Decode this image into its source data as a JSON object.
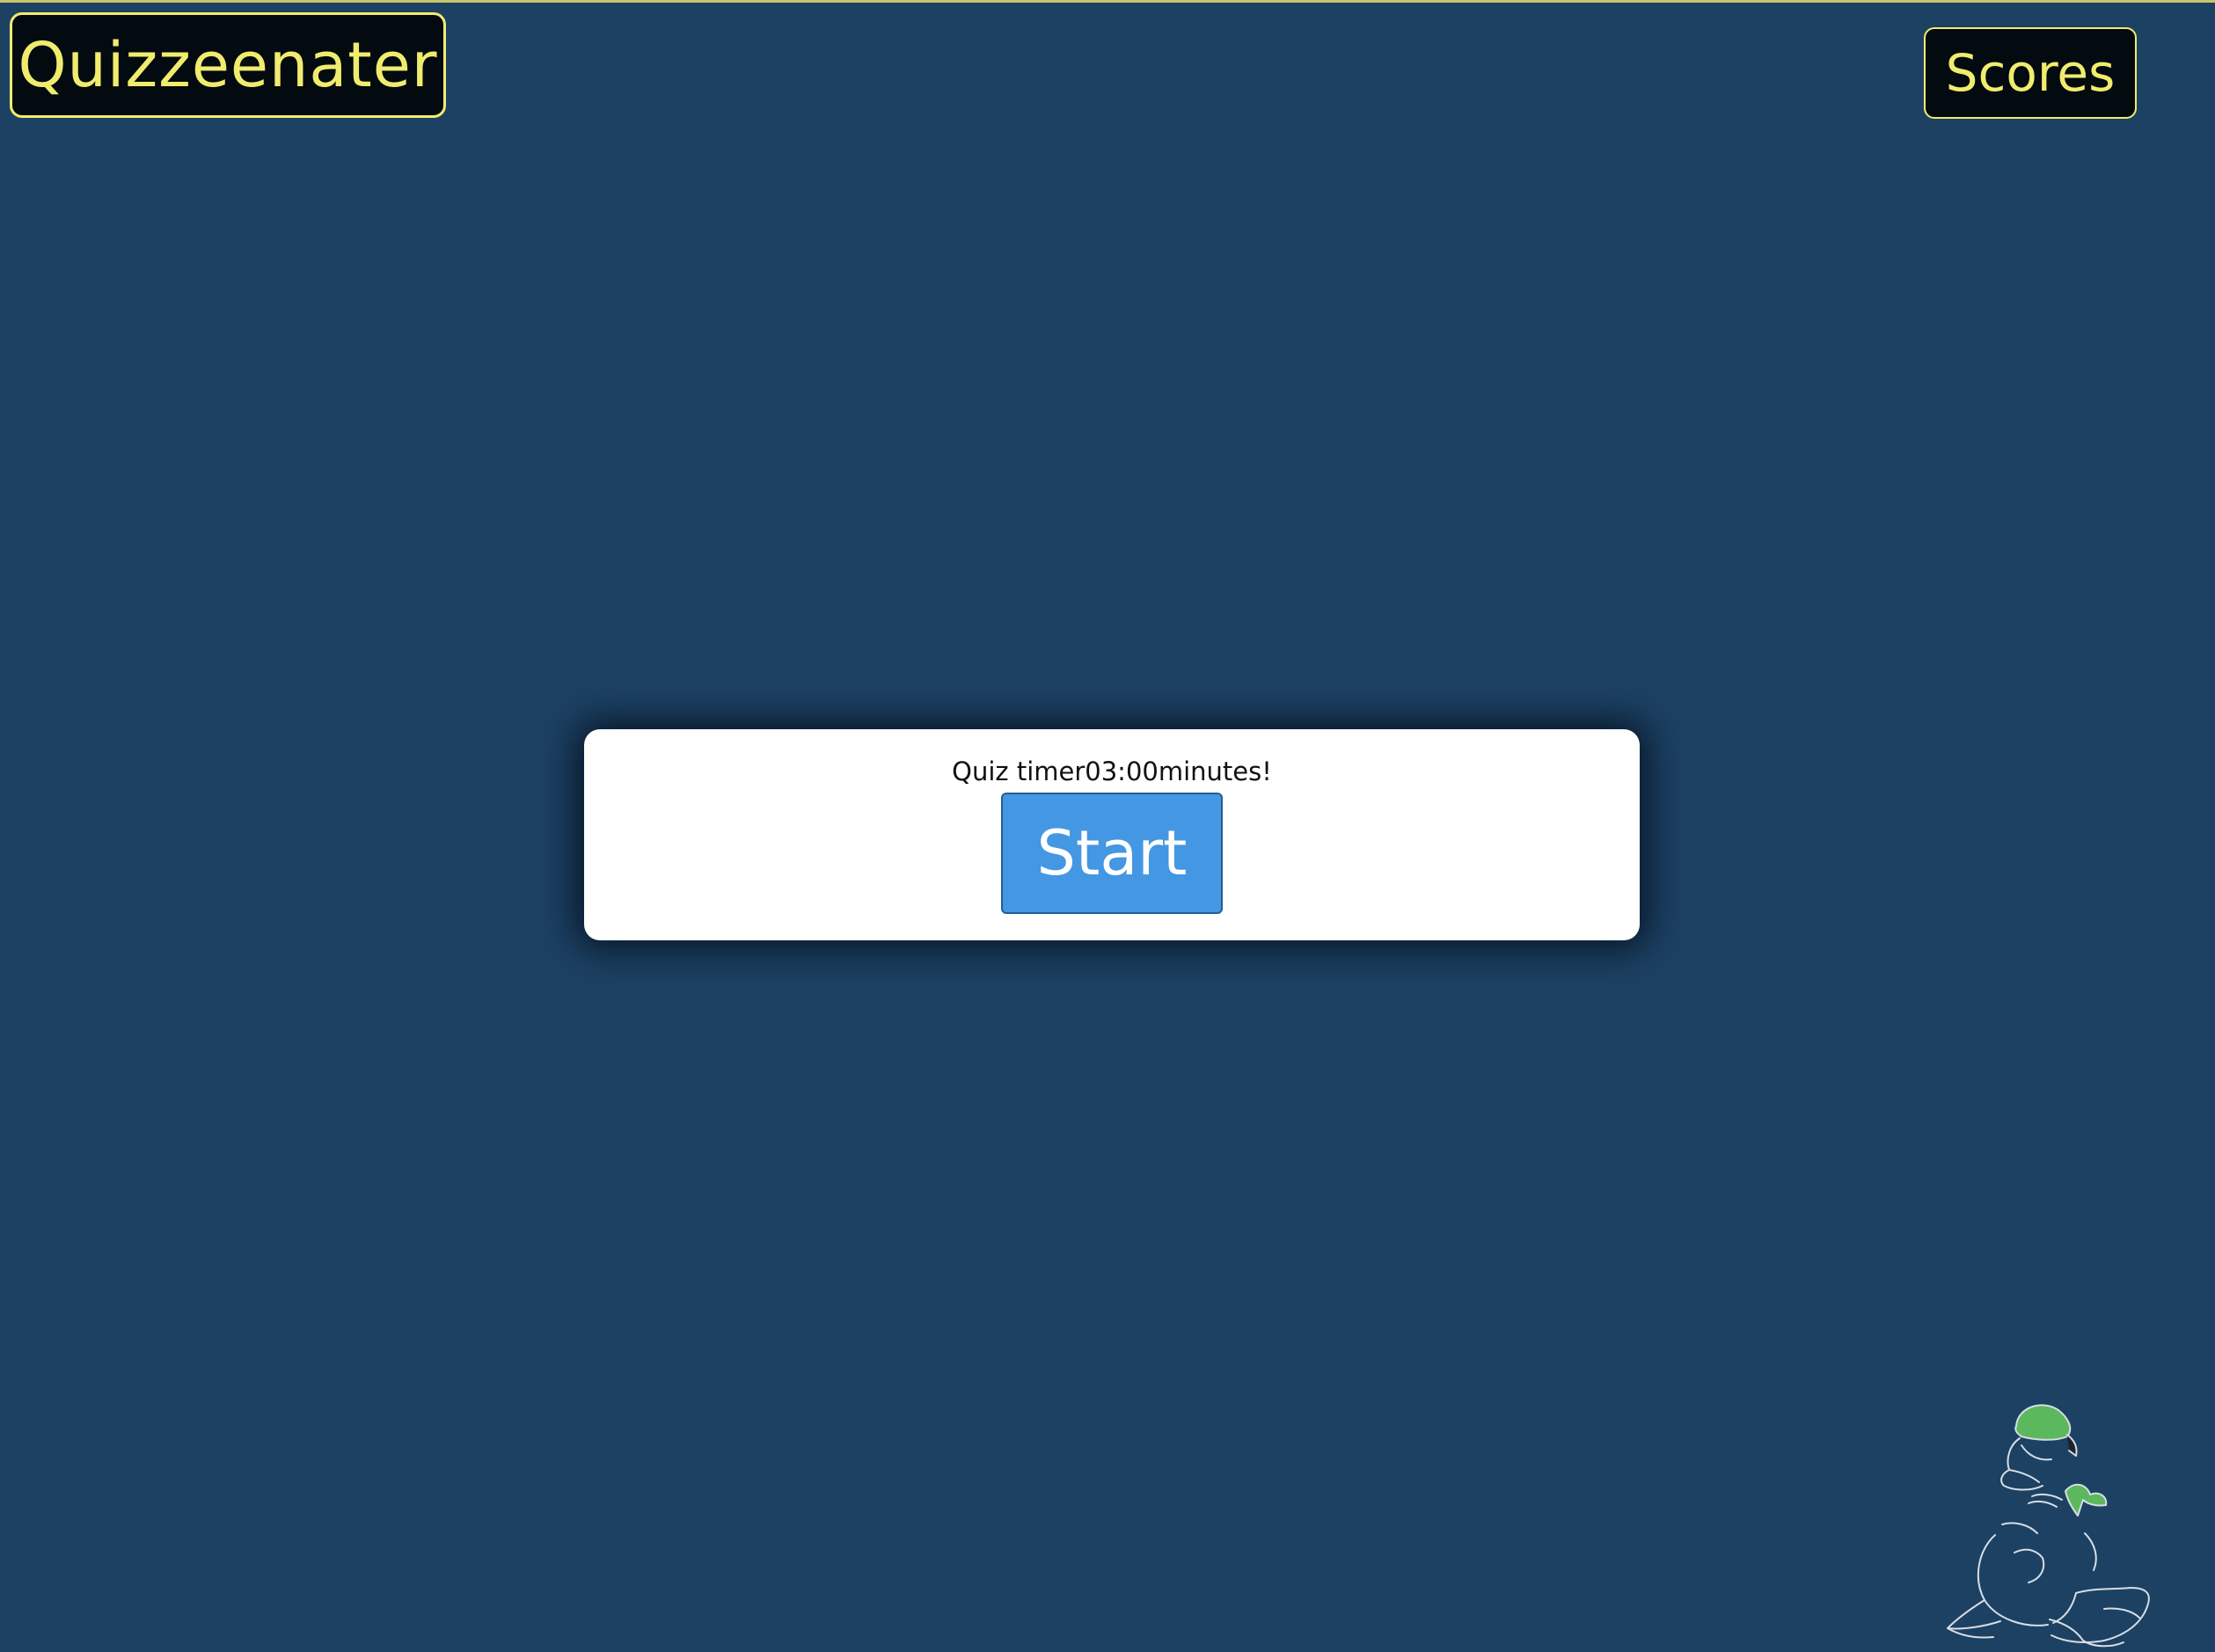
{
  "header": {
    "brand": "Quizzeenater",
    "scores_label": "Scores"
  },
  "card": {
    "timer_prefix": "Quiz timer",
    "timer_value": "03:00",
    "timer_suffix": "minutes!",
    "start_label": "Start"
  },
  "mascot": {
    "icon": "duck-mascot-icon"
  },
  "colors": {
    "background": "#1c4163",
    "accent_yellow": "#f1ec6d",
    "button_blue": "#4497e2",
    "mascot_green": "#5cb85c"
  }
}
